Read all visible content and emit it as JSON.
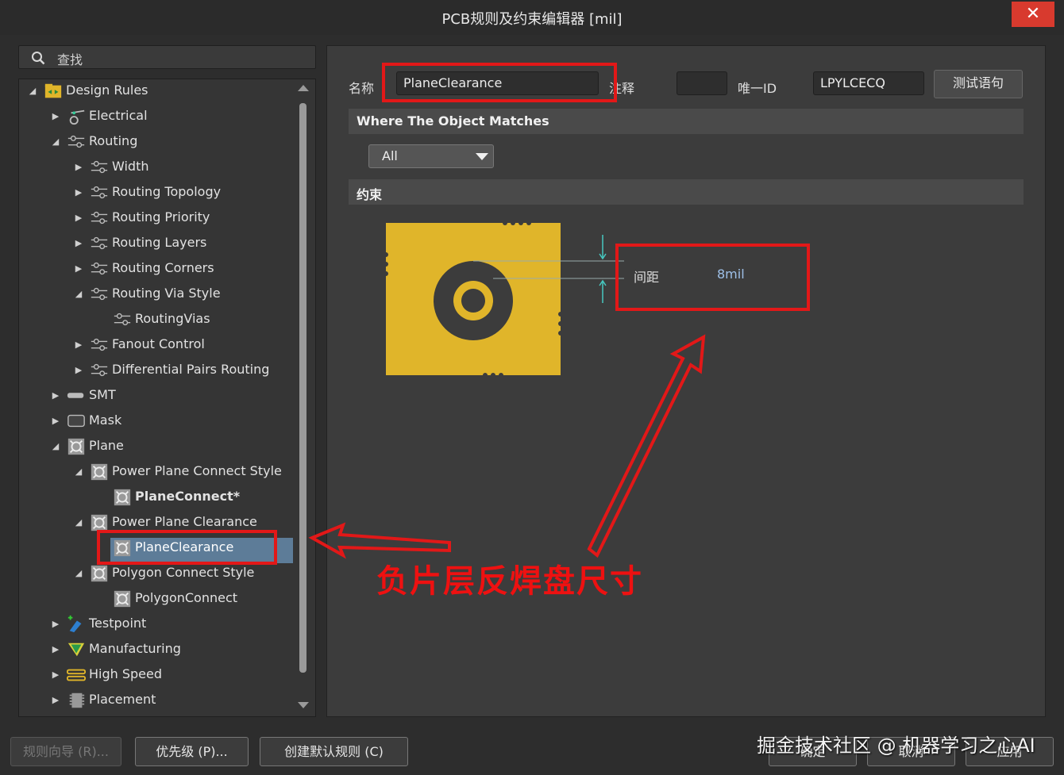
{
  "window": {
    "title": "PCB规则及约束编辑器 [mil]",
    "close_glyph": "✕"
  },
  "search": {
    "placeholder": "查找"
  },
  "tree": {
    "items": [
      {
        "label": "Design Rules",
        "icon": "design-rules-icon",
        "arrow": "◢"
      },
      {
        "label": "Electrical",
        "icon": "electrical-icon",
        "arrow": "▶"
      },
      {
        "label": "Routing",
        "icon": "routing-icon",
        "arrow": "◢"
      },
      {
        "label": "Width",
        "icon": "routing-icon",
        "arrow": "▶"
      },
      {
        "label": "Routing Topology",
        "icon": "routing-icon",
        "arrow": "▶"
      },
      {
        "label": "Routing Priority",
        "icon": "routing-icon",
        "arrow": "▶"
      },
      {
        "label": "Routing Layers",
        "icon": "routing-icon",
        "arrow": "▶"
      },
      {
        "label": "Routing Corners",
        "icon": "routing-icon",
        "arrow": "▶"
      },
      {
        "label": "Routing Via Style",
        "icon": "routing-icon",
        "arrow": "◢"
      },
      {
        "label": "RoutingVias",
        "icon": "routing-icon",
        "arrow": ""
      },
      {
        "label": "Fanout Control",
        "icon": "routing-icon",
        "arrow": "▶"
      },
      {
        "label": "Differential Pairs Routing",
        "icon": "routing-icon",
        "arrow": "▶"
      },
      {
        "label": "SMT",
        "icon": "smt-icon",
        "arrow": "▶"
      },
      {
        "label": "Mask",
        "icon": "mask-icon",
        "arrow": "▶"
      },
      {
        "label": "Plane",
        "icon": "plane-icon",
        "arrow": "◢"
      },
      {
        "label": "Power Plane Connect Style",
        "icon": "plane-icon",
        "arrow": "◢"
      },
      {
        "label": "PlaneConnect*",
        "icon": "plane-icon",
        "arrow": ""
      },
      {
        "label": "Power Plane Clearance",
        "icon": "plane-icon",
        "arrow": "◢"
      },
      {
        "label": "PlaneClearance",
        "icon": "plane-icon",
        "arrow": ""
      },
      {
        "label": "Polygon Connect Style",
        "icon": "plane-icon",
        "arrow": "◢"
      },
      {
        "label": "PolygonConnect",
        "icon": "plane-icon",
        "arrow": ""
      },
      {
        "label": "Testpoint",
        "icon": "testpoint-icon",
        "arrow": "▶"
      },
      {
        "label": "Manufacturing",
        "icon": "manufacturing-icon",
        "arrow": "▶"
      },
      {
        "label": "High Speed",
        "icon": "high-speed-icon",
        "arrow": "▶"
      },
      {
        "label": "Placement",
        "icon": "placement-icon",
        "arrow": "▶"
      }
    ]
  },
  "rule": {
    "name_label": "名称",
    "name_value": "PlaneClearance",
    "comment_label": "注释",
    "comment_value": "",
    "uid_label": "唯一ID",
    "uid_value": "LPYLCECQ",
    "test_button": "测试语句",
    "where_header": "Where The Object Matches",
    "match_value": "All",
    "constraints_header": "约束",
    "clearance_label": "间距",
    "clearance_value": "8mil"
  },
  "footer": {
    "wizard": "规则向导 (R)...",
    "priority": "优先级 (P)...",
    "default_rules": "创建默认规则 (C)",
    "ok": "确定",
    "cancel": "取消",
    "apply": "应用"
  },
  "annotation": {
    "text": "负片层反焊盘尺寸"
  },
  "watermark": "掘金技术社区 @ 机器学习之心AI",
  "colors": {
    "accent_red": "#e21818",
    "copper": "#e0b52a",
    "selection": "#5d7c98"
  }
}
